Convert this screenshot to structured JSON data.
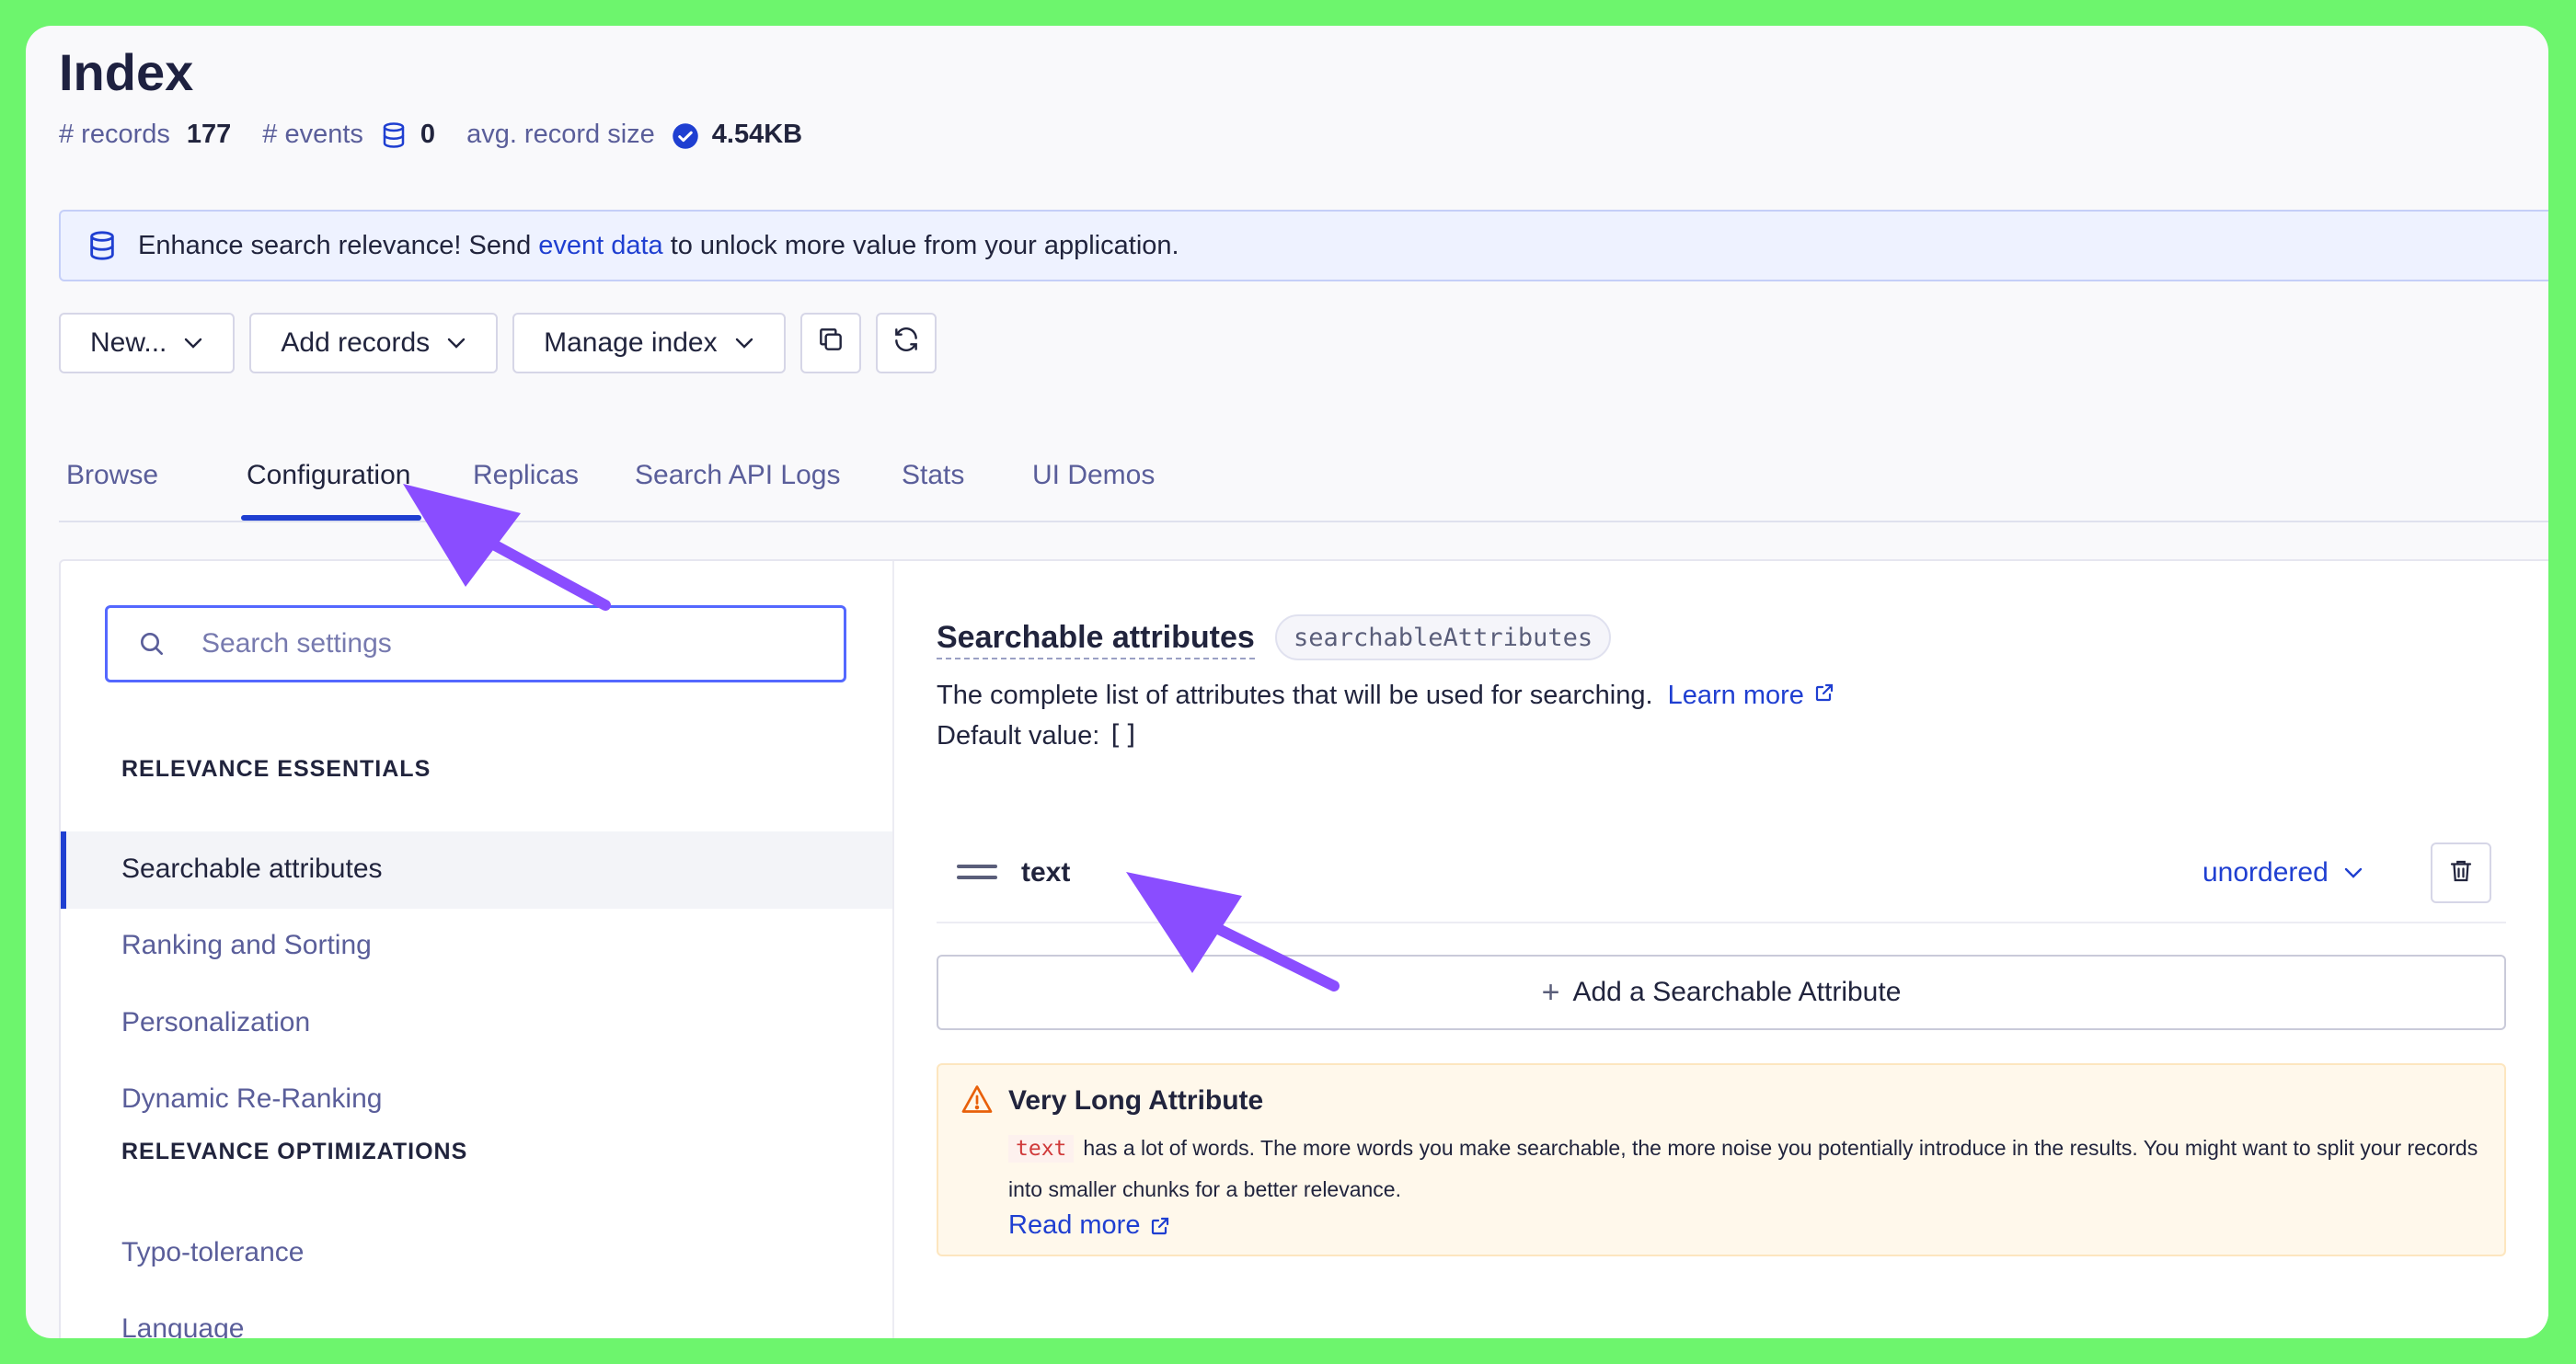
{
  "header": {
    "title": "Index",
    "stats": {
      "records_label": "# records",
      "records_value": "177",
      "events_label": "# events",
      "events_value": "0",
      "size_label": "avg. record size",
      "size_value": "4.54KB"
    }
  },
  "banner": {
    "text_before": "Enhance search relevance! Send",
    "link": "event data",
    "text_after": "to unlock more value from your application."
  },
  "toolbar": {
    "new_label": "New...",
    "add_records_label": "Add records",
    "manage_index_label": "Manage index"
  },
  "tabs": [
    {
      "label": "Browse"
    },
    {
      "label": "Configuration"
    },
    {
      "label": "Replicas"
    },
    {
      "label": "Search API Logs"
    },
    {
      "label": "Stats"
    },
    {
      "label": "UI Demos"
    }
  ],
  "sidebar": {
    "search_placeholder": "Search settings",
    "section1": "RELEVANCE ESSENTIALS",
    "items1": [
      "Searchable attributes",
      "Ranking and Sorting",
      "Personalization",
      "Dynamic Re-Ranking"
    ],
    "section2": "RELEVANCE OPTIMIZATIONS",
    "items2": [
      "Typo-tolerance",
      "Language"
    ]
  },
  "content": {
    "title": "Searchable attributes",
    "code": "searchableAttributes",
    "description": "The complete list of attributes that will be used for searching.",
    "learn_more": "Learn more",
    "default_label": "Default value:",
    "default_value": "[]",
    "attribute": {
      "name": "text",
      "order": "unordered"
    },
    "add_label": "Add a Searchable Attribute",
    "warning": {
      "title": "Very Long Attribute",
      "code": "text",
      "body": "has a lot of words. The more words you make searchable, the more noise you potentially introduce in the results. You might want to split your records into smaller chunks for a better relevance.",
      "link": "Read more"
    }
  },
  "colors": {
    "background": "#6df56d",
    "accent": "#1f3fd1",
    "annotation_arrow": "#8a4dff"
  }
}
